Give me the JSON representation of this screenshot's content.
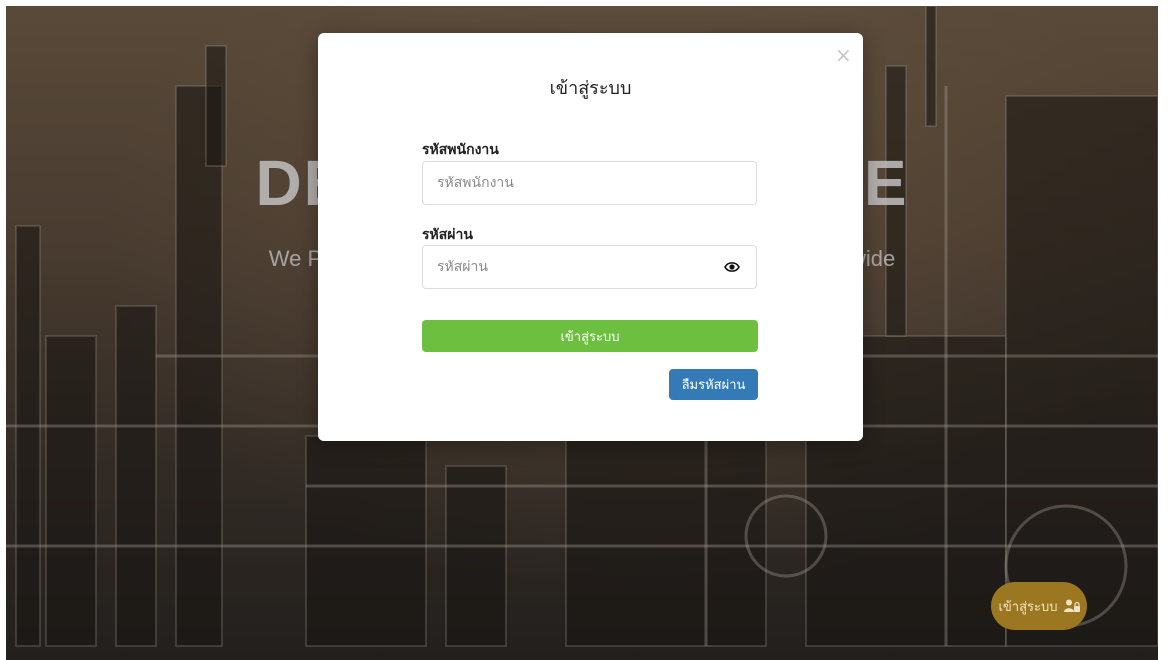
{
  "hero": {
    "title": "DELIVERING VALUE",
    "subtitle": "We Provide Innovative Solutions to Energy Industries Worldwide"
  },
  "modal": {
    "title": "เข้าสู่ระบบ",
    "close_icon": "×",
    "employee_id": {
      "label": "รหัสพนักงาน",
      "placeholder": "รหัสพนักงาน",
      "value": ""
    },
    "password": {
      "label": "รหัสผ่าน",
      "placeholder": "รหัสผ่าน",
      "value": "",
      "toggle_icon": "eye-icon"
    },
    "login_label": "เข้าสู่ระบบ",
    "forgot_label": "ลืมรหัสผ่าน"
  },
  "fab": {
    "label": "เข้าสู่ระบบ",
    "icon": "user-lock-icon"
  },
  "colors": {
    "login_green": "#6cbf3f",
    "forgot_blue": "#337ab7",
    "fab_gold": "#9b7722"
  }
}
